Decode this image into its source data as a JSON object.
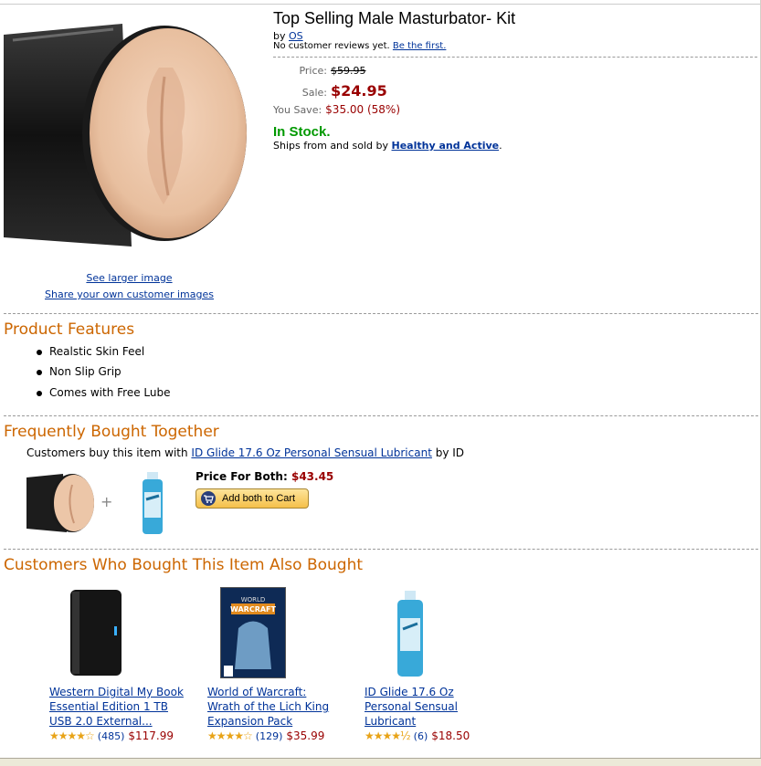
{
  "product": {
    "title": "Top Selling Male Masturbator- Kit",
    "by_prefix": "by",
    "brand": "OS",
    "reviews_text": "No customer reviews yet.",
    "reviews_link": "Be the first.",
    "see_larger": "See larger image",
    "share_images": "Share your own customer images"
  },
  "pricing": {
    "price_label": "Price:",
    "price": "$59.95",
    "sale_label": "Sale:",
    "sale": "$24.95",
    "save_label": "You Save:",
    "save": "$35.00 (58%)"
  },
  "availability": {
    "stock": "In Stock.",
    "ships_text": "Ships from and sold by",
    "seller": "Healthy and Active",
    "ships_end": "."
  },
  "features": {
    "heading": "Product Features",
    "items": [
      "Realstic Skin Feel",
      "Non Slip Grip",
      "Comes with Free Lube"
    ]
  },
  "fbt": {
    "heading": "Frequently Bought Together",
    "line_prefix": "Customers buy this item with",
    "item_link": "ID Glide 17.6 Oz Personal Sensual Lubricant",
    "line_suffix": "by ID",
    "plus": "+",
    "price_label": "Price For Both:",
    "price": "$43.45",
    "button": "Add both to Cart"
  },
  "also_bought": {
    "heading": "Customers Who Bought This Item Also Bought",
    "items": [
      {
        "l1": "Western Digital My Book",
        "l2": "Essential Edition 1 TB",
        "l3": "USB 2.0 External...",
        "count": "(485)",
        "price": "$117.99"
      },
      {
        "l1": "World of Warcraft:",
        "l2": "Wrath of the Lich King",
        "l3": "Expansion Pack",
        "count": "(129)",
        "price": "$35.99"
      },
      {
        "l1": "ID Glide 17.6 Oz",
        "l2": "Personal Sensual",
        "l3": "Lubricant",
        "count": "(6)",
        "price": "$18.50"
      }
    ]
  },
  "colors": {
    "section": "#cc6600",
    "price": "#990000",
    "link": "#003399",
    "stock": "#009900"
  }
}
